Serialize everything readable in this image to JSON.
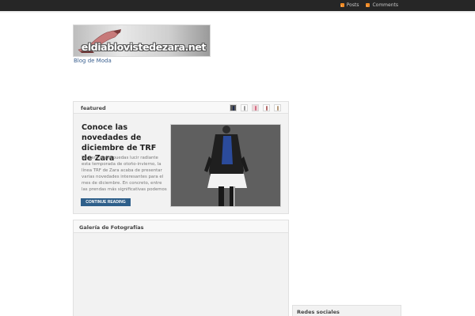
{
  "topbar": {
    "links": [
      {
        "label": "Posts",
        "icon": "rss-icon"
      },
      {
        "label": "Comments",
        "icon": "rss-icon"
      }
    ]
  },
  "header": {
    "logo_text": "eldiablovistedezara.net",
    "tagline": "Blog de Moda"
  },
  "featured": {
    "title": "featured",
    "post": {
      "title": "Conoce las novedades de diciembre de TRF de Zara",
      "excerpt": "De cara a que puedas lucir radiante esta temporada de otoño-invierno, la línea TRF de Zara acaba de presentar varias novedades interesantes para el mes de diciembre. En concreto, entre las prendas más significativas podemos destacar las siguientes, que",
      "button_label": "CONTINUE READING"
    }
  },
  "gallery": {
    "title": "Galería de Fotografías"
  },
  "sidebar": {
    "social_title": "Redes sociales"
  },
  "colors": {
    "topbar": "#262626",
    "accent": "#2e5f8a",
    "rss": "#f08a24"
  }
}
